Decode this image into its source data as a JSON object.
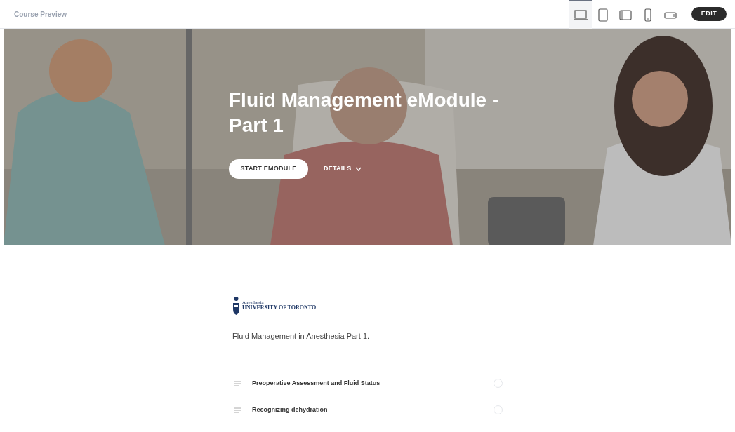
{
  "header": {
    "title": "Course Preview",
    "devices": [
      {
        "kind": "laptop",
        "selected": true
      },
      {
        "kind": "tablet",
        "selected": false
      },
      {
        "kind": "tablet-landscape",
        "selected": false
      },
      {
        "kind": "phone",
        "selected": false
      },
      {
        "kind": "phone-landscape",
        "selected": false
      }
    ],
    "edit_button": "EDIT"
  },
  "hero": {
    "title": "Fluid Management eModule - Part 1",
    "start_button": "START EMODULE",
    "details_button": "DETAILS"
  },
  "logo": {
    "department": "Anesthesia",
    "university": "UNIVERSITY OF TORONTO"
  },
  "description": "Fluid Management in Anesthesia Part 1.",
  "lessons": [
    {
      "title": "Preoperative Assessment and Fluid Status",
      "completed": false
    },
    {
      "title": "Recognizing dehydration",
      "completed": false
    }
  ]
}
